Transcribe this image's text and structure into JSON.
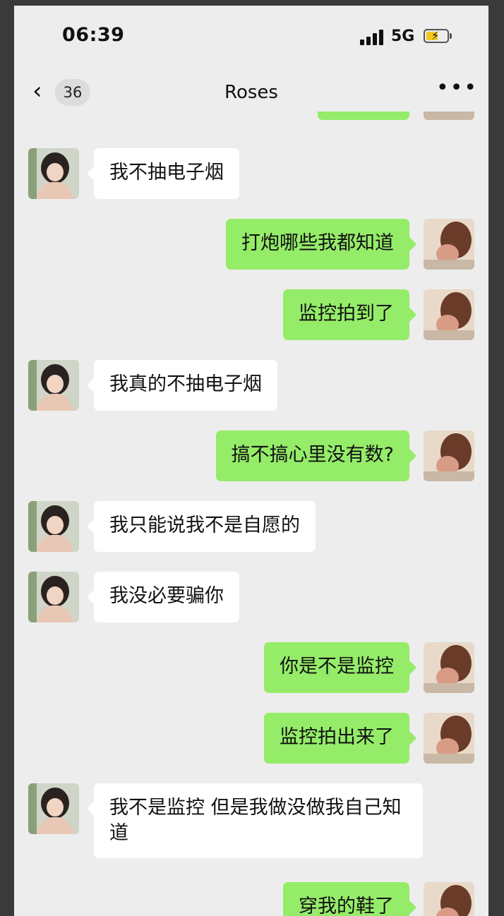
{
  "status_bar": {
    "time": "06:39",
    "network": "5G"
  },
  "nav": {
    "unread_count": "36",
    "title": "Roses"
  },
  "messages": [
    {
      "side": "right",
      "text": ""
    },
    {
      "side": "left",
      "text": "我不抽电子烟"
    },
    {
      "side": "right",
      "text": "打炮哪些我都知道"
    },
    {
      "side": "right",
      "text": "监控拍到了"
    },
    {
      "side": "left",
      "text": "我真的不抽电子烟"
    },
    {
      "side": "right",
      "text": "搞不搞心里没有数?"
    },
    {
      "side": "left",
      "text": "我只能说我不是自愿的"
    },
    {
      "side": "left",
      "text": "我没必要骗你"
    },
    {
      "side": "right",
      "text": "你是不是监控"
    },
    {
      "side": "right",
      "text": "监控拍出来了"
    },
    {
      "side": "left",
      "text": "我不是监控 但是我做没做我自己知道"
    },
    {
      "side": "right",
      "text": "穿我的鞋了"
    }
  ],
  "colors": {
    "background": "#ededed",
    "self_bubble": "#95ec69",
    "other_bubble": "#ffffff"
  },
  "icons": [
    "signal-icon",
    "battery-charging-icon",
    "back-chevron-icon",
    "more-options-icon",
    "contact-avatar",
    "self-avatar"
  ]
}
